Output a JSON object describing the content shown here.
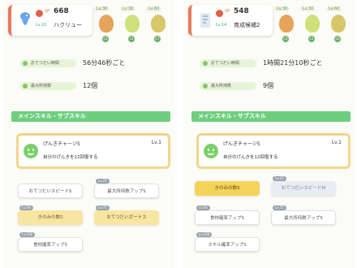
{
  "left": {
    "sp_label": "SP",
    "sp_value": "668",
    "lv_label": "Lv.10",
    "name": "ハクリュー",
    "minis": [
      {
        "lv": "Lv.30",
        "tag": "C2",
        "color": "#e7a35a"
      },
      {
        "lv": "Lv.30",
        "tag": "C1",
        "color": "#cfe07a"
      },
      {
        "lv": "Lv.60",
        "tag": "C7",
        "color": "#d8c66a"
      }
    ],
    "stats": [
      {
        "label": "おてつだい時間",
        "value": "56分46秒ごと"
      },
      {
        "label": "最大所持数",
        "value": "12個"
      }
    ],
    "skill_header": "メインスキル・サブスキル",
    "main_skill": {
      "name": "げんきチャージS",
      "lv": "Lv.1",
      "desc": "自分のげんきを12回復する"
    },
    "subs": [
      {
        "lvbadge": "",
        "label": "おてつだいスピードS",
        "style": "plain"
      },
      {
        "lvbadge": "Lv.25",
        "label": "最大所持数アップS",
        "style": "plain"
      },
      {
        "lvbadge": "Lv.50",
        "label": "きのみの数S",
        "style": "gold"
      },
      {
        "lvbadge": "Lv.75",
        "label": "おてつだいボーナス",
        "style": "gold"
      },
      {
        "lvbadge": "Lv.100",
        "label": "食材確率アップS",
        "style": "plain"
      }
    ]
  },
  "right": {
    "sp_label": "SP",
    "sp_value": "548",
    "lv_label": "Lv.14",
    "name": "育成候補2",
    "minis": [
      {
        "lv": "Lv.30",
        "tag": "C2",
        "color": "#e7a35a"
      },
      {
        "lv": "Lv.30",
        "tag": "C1",
        "color": "#cfe07a"
      },
      {
        "lv": "Lv.60",
        "tag": "C6",
        "color": "#d8c66a"
      }
    ],
    "stats": [
      {
        "label": "おてつだい時間",
        "value": "1時間21分10秒ごと"
      },
      {
        "label": "最大所持数",
        "value": "9個"
      }
    ],
    "skill_header": "メインスキル・サブスキル",
    "main_skill": {
      "name": "げんきチャージS",
      "lv": "Lv.1",
      "desc": "自分のげんきを12回復する"
    },
    "subs": [
      {
        "lvbadge": "",
        "label": "きのみの数S",
        "style": "goldsolid"
      },
      {
        "lvbadge": "Lv.25",
        "label": "おてつだいスピードM",
        "style": "grey"
      },
      {
        "lvbadge": "Lv.50",
        "label": "食材確率アップS",
        "style": "plain"
      },
      {
        "lvbadge": "Lv.75",
        "label": "最大所持数アップS",
        "style": "plain"
      },
      {
        "lvbadge": "Lv.100",
        "label": "スキル確率アップS",
        "style": "plain"
      }
    ]
  }
}
